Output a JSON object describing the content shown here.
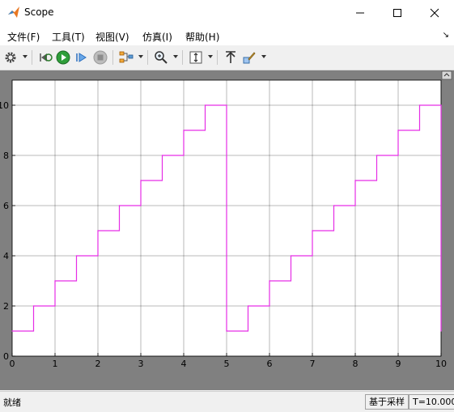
{
  "window": {
    "title": "Scope"
  },
  "menu": {
    "items": [
      "文件(F)",
      "工具(T)",
      "视图(V)",
      "仿真(I)",
      "帮助(H)"
    ]
  },
  "status": {
    "left": "就绪",
    "mode": "基于采样",
    "time": "T=10.000"
  },
  "colors": {
    "signal": "#e62de6",
    "axes_bg": "#ffffff",
    "grid": "#000000",
    "frame": "#808080"
  },
  "toolbar_icons": [
    "gear-icon",
    "rewind-icon",
    "run-icon",
    "step-forward-icon",
    "stop-icon",
    "signal-selection-icon",
    "zoom-icon",
    "autoscale-icon",
    "highlight-icon",
    "brush-icon"
  ],
  "chart_data": {
    "type": "line",
    "title": "",
    "xlabel": "",
    "ylabel": "",
    "xlim": [
      0,
      10
    ],
    "ylim": [
      0,
      11
    ],
    "xticks": [
      0,
      1,
      2,
      3,
      4,
      5,
      6,
      7,
      8,
      9,
      10
    ],
    "yticks": [
      0,
      2,
      4,
      6,
      8,
      10
    ],
    "grid": true,
    "series": [
      {
        "step": "post",
        "x": [
          0,
          0.5,
          1,
          1.5,
          2,
          2.5,
          3,
          3.5,
          4,
          4.5,
          5,
          5.5,
          6,
          6.5,
          7,
          7.5,
          8,
          8.5,
          9,
          9.5,
          10
        ],
        "y": [
          1,
          2,
          3,
          4,
          5,
          6,
          7,
          8,
          9,
          10,
          1,
          2,
          3,
          4,
          5,
          6,
          7,
          8,
          9,
          10,
          1
        ]
      }
    ]
  }
}
